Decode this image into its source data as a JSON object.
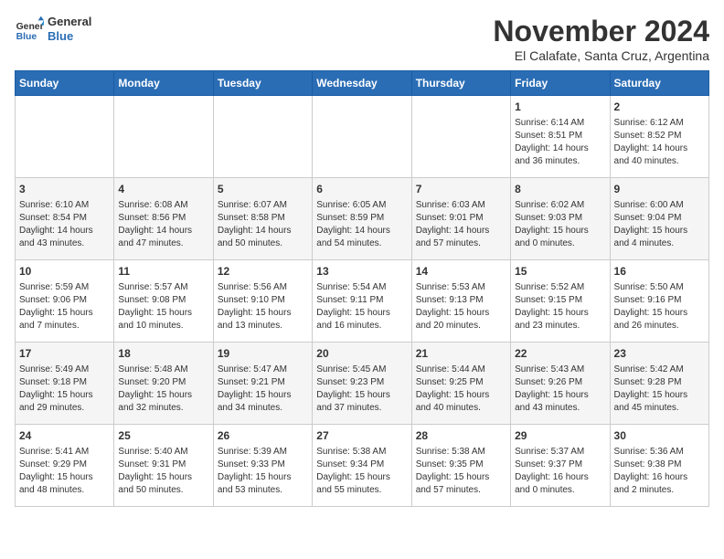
{
  "header": {
    "logo_line1": "General",
    "logo_line2": "Blue",
    "title": "November 2024",
    "subtitle": "El Calafate, Santa Cruz, Argentina"
  },
  "weekdays": [
    "Sunday",
    "Monday",
    "Tuesday",
    "Wednesday",
    "Thursday",
    "Friday",
    "Saturday"
  ],
  "weeks": [
    [
      {
        "day": "",
        "content": ""
      },
      {
        "day": "",
        "content": ""
      },
      {
        "day": "",
        "content": ""
      },
      {
        "day": "",
        "content": ""
      },
      {
        "day": "",
        "content": ""
      },
      {
        "day": "1",
        "content": "Sunrise: 6:14 AM\nSunset: 8:51 PM\nDaylight: 14 hours\nand 36 minutes."
      },
      {
        "day": "2",
        "content": "Sunrise: 6:12 AM\nSunset: 8:52 PM\nDaylight: 14 hours\nand 40 minutes."
      }
    ],
    [
      {
        "day": "3",
        "content": "Sunrise: 6:10 AM\nSunset: 8:54 PM\nDaylight: 14 hours\nand 43 minutes."
      },
      {
        "day": "4",
        "content": "Sunrise: 6:08 AM\nSunset: 8:56 PM\nDaylight: 14 hours\nand 47 minutes."
      },
      {
        "day": "5",
        "content": "Sunrise: 6:07 AM\nSunset: 8:58 PM\nDaylight: 14 hours\nand 50 minutes."
      },
      {
        "day": "6",
        "content": "Sunrise: 6:05 AM\nSunset: 8:59 PM\nDaylight: 14 hours\nand 54 minutes."
      },
      {
        "day": "7",
        "content": "Sunrise: 6:03 AM\nSunset: 9:01 PM\nDaylight: 14 hours\nand 57 minutes."
      },
      {
        "day": "8",
        "content": "Sunrise: 6:02 AM\nSunset: 9:03 PM\nDaylight: 15 hours\nand 0 minutes."
      },
      {
        "day": "9",
        "content": "Sunrise: 6:00 AM\nSunset: 9:04 PM\nDaylight: 15 hours\nand 4 minutes."
      }
    ],
    [
      {
        "day": "10",
        "content": "Sunrise: 5:59 AM\nSunset: 9:06 PM\nDaylight: 15 hours\nand 7 minutes."
      },
      {
        "day": "11",
        "content": "Sunrise: 5:57 AM\nSunset: 9:08 PM\nDaylight: 15 hours\nand 10 minutes."
      },
      {
        "day": "12",
        "content": "Sunrise: 5:56 AM\nSunset: 9:10 PM\nDaylight: 15 hours\nand 13 minutes."
      },
      {
        "day": "13",
        "content": "Sunrise: 5:54 AM\nSunset: 9:11 PM\nDaylight: 15 hours\nand 16 minutes."
      },
      {
        "day": "14",
        "content": "Sunrise: 5:53 AM\nSunset: 9:13 PM\nDaylight: 15 hours\nand 20 minutes."
      },
      {
        "day": "15",
        "content": "Sunrise: 5:52 AM\nSunset: 9:15 PM\nDaylight: 15 hours\nand 23 minutes."
      },
      {
        "day": "16",
        "content": "Sunrise: 5:50 AM\nSunset: 9:16 PM\nDaylight: 15 hours\nand 26 minutes."
      }
    ],
    [
      {
        "day": "17",
        "content": "Sunrise: 5:49 AM\nSunset: 9:18 PM\nDaylight: 15 hours\nand 29 minutes."
      },
      {
        "day": "18",
        "content": "Sunrise: 5:48 AM\nSunset: 9:20 PM\nDaylight: 15 hours\nand 32 minutes."
      },
      {
        "day": "19",
        "content": "Sunrise: 5:47 AM\nSunset: 9:21 PM\nDaylight: 15 hours\nand 34 minutes."
      },
      {
        "day": "20",
        "content": "Sunrise: 5:45 AM\nSunset: 9:23 PM\nDaylight: 15 hours\nand 37 minutes."
      },
      {
        "day": "21",
        "content": "Sunrise: 5:44 AM\nSunset: 9:25 PM\nDaylight: 15 hours\nand 40 minutes."
      },
      {
        "day": "22",
        "content": "Sunrise: 5:43 AM\nSunset: 9:26 PM\nDaylight: 15 hours\nand 43 minutes."
      },
      {
        "day": "23",
        "content": "Sunrise: 5:42 AM\nSunset: 9:28 PM\nDaylight: 15 hours\nand 45 minutes."
      }
    ],
    [
      {
        "day": "24",
        "content": "Sunrise: 5:41 AM\nSunset: 9:29 PM\nDaylight: 15 hours\nand 48 minutes."
      },
      {
        "day": "25",
        "content": "Sunrise: 5:40 AM\nSunset: 9:31 PM\nDaylight: 15 hours\nand 50 minutes."
      },
      {
        "day": "26",
        "content": "Sunrise: 5:39 AM\nSunset: 9:33 PM\nDaylight: 15 hours\nand 53 minutes."
      },
      {
        "day": "27",
        "content": "Sunrise: 5:38 AM\nSunset: 9:34 PM\nDaylight: 15 hours\nand 55 minutes."
      },
      {
        "day": "28",
        "content": "Sunrise: 5:38 AM\nSunset: 9:35 PM\nDaylight: 15 hours\nand 57 minutes."
      },
      {
        "day": "29",
        "content": "Sunrise: 5:37 AM\nSunset: 9:37 PM\nDaylight: 16 hours\nand 0 minutes."
      },
      {
        "day": "30",
        "content": "Sunrise: 5:36 AM\nSunset: 9:38 PM\nDaylight: 16 hours\nand 2 minutes."
      }
    ]
  ]
}
